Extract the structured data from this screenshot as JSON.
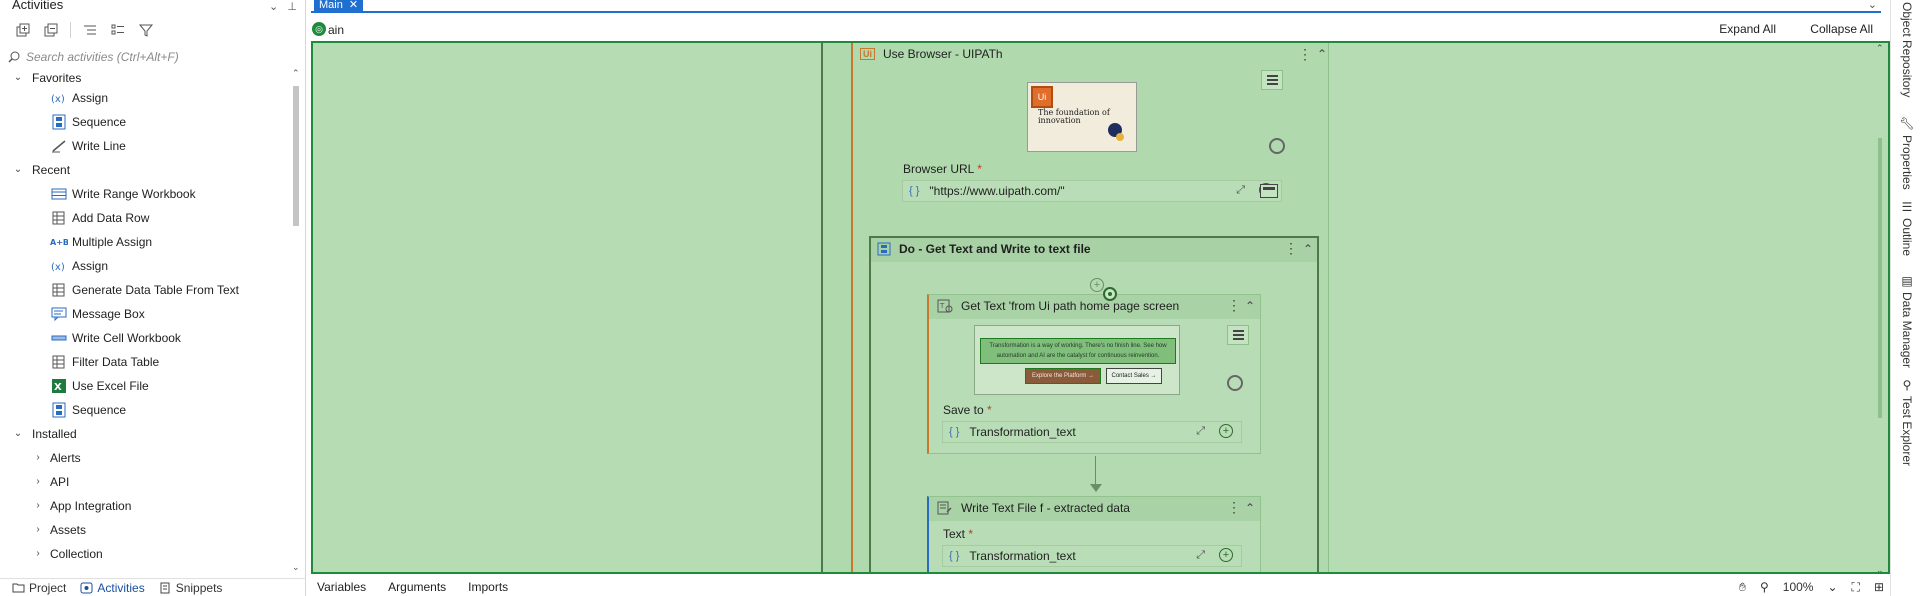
{
  "left_panel": {
    "title": "Activities",
    "search_placeholder": "Search activities (Ctrl+Alt+F)",
    "favorites_label": "Favorites",
    "recent_label": "Recent",
    "installed_label": "Installed",
    "favorites": [
      {
        "label": "Assign",
        "icon": "assign-icon"
      },
      {
        "label": "Sequence",
        "icon": "sequence-icon"
      },
      {
        "label": "Write Line",
        "icon": "write-line-icon"
      }
    ],
    "recent": [
      {
        "label": "Write Range Workbook",
        "icon": "range-icon"
      },
      {
        "label": "Add Data Row",
        "icon": "datatable-icon"
      },
      {
        "label": "Multiple Assign",
        "icon": "multiple-assign-icon"
      },
      {
        "label": "Assign",
        "icon": "assign-icon"
      },
      {
        "label": "Generate Data Table From Text",
        "icon": "datatable-icon"
      },
      {
        "label": "Message Box",
        "icon": "message-box-icon"
      },
      {
        "label": "Write Cell Workbook",
        "icon": "cell-icon"
      },
      {
        "label": "Filter Data Table",
        "icon": "datatable-icon"
      },
      {
        "label": "Use Excel File",
        "icon": "excel-icon"
      },
      {
        "label": "Sequence",
        "icon": "sequence-icon"
      }
    ],
    "installed": [
      {
        "label": "Alerts"
      },
      {
        "label": "API"
      },
      {
        "label": "App Integration"
      },
      {
        "label": "Assets"
      },
      {
        "label": "Collection"
      }
    ],
    "bottom_tabs": [
      {
        "label": "Project",
        "active": false
      },
      {
        "label": "Activities",
        "active": true
      },
      {
        "label": "Snippets",
        "active": false
      }
    ]
  },
  "document": {
    "tab_label": "Main",
    "breadcrumb": "ain",
    "expand_all": "Expand All",
    "collapse_all": "Collapse All"
  },
  "workflow": {
    "use_browser": {
      "title": "Use Browser - UIPATh",
      "badge": "Ui",
      "url_label": "Browser URL",
      "url_value": "\"https://www.uipath.com/\"",
      "thumbnail_headline": "The foundation of innovation"
    },
    "sequence": {
      "title": "Do - Get Text and Write to text file"
    },
    "get_text": {
      "title": "Get Text 'from Ui path  home page screen",
      "screen_text": "Transformation is a way of working. There's no finish line. See how automation and AI are the catalyst for continuous reinvention.",
      "screen_button_1": "Explore the Platform →",
      "screen_button_2": "Contact Sales →",
      "save_label": "Save to",
      "save_value": "Transformation_text"
    },
    "write_text_file": {
      "title": "Write Text File f - extracted data",
      "text_label": "Text",
      "text_value": "Transformation_text"
    },
    "required_marker": "*",
    "brace": "{ }"
  },
  "right_tabs": [
    {
      "label": "Object Repository"
    },
    {
      "label": "Properties"
    },
    {
      "label": "Outline"
    },
    {
      "label": "Data Manager"
    },
    {
      "label": "Test Explorer"
    }
  ],
  "bottom_bar": {
    "tabs": [
      "Variables",
      "Arguments",
      "Imports"
    ],
    "zoom": "100%"
  },
  "colors": {
    "canvas_bg": "#b6dcb3",
    "canvas_border": "#1e8a3c",
    "accent_blue": "#1f6fd1",
    "activity_rail": "#c8782c"
  }
}
